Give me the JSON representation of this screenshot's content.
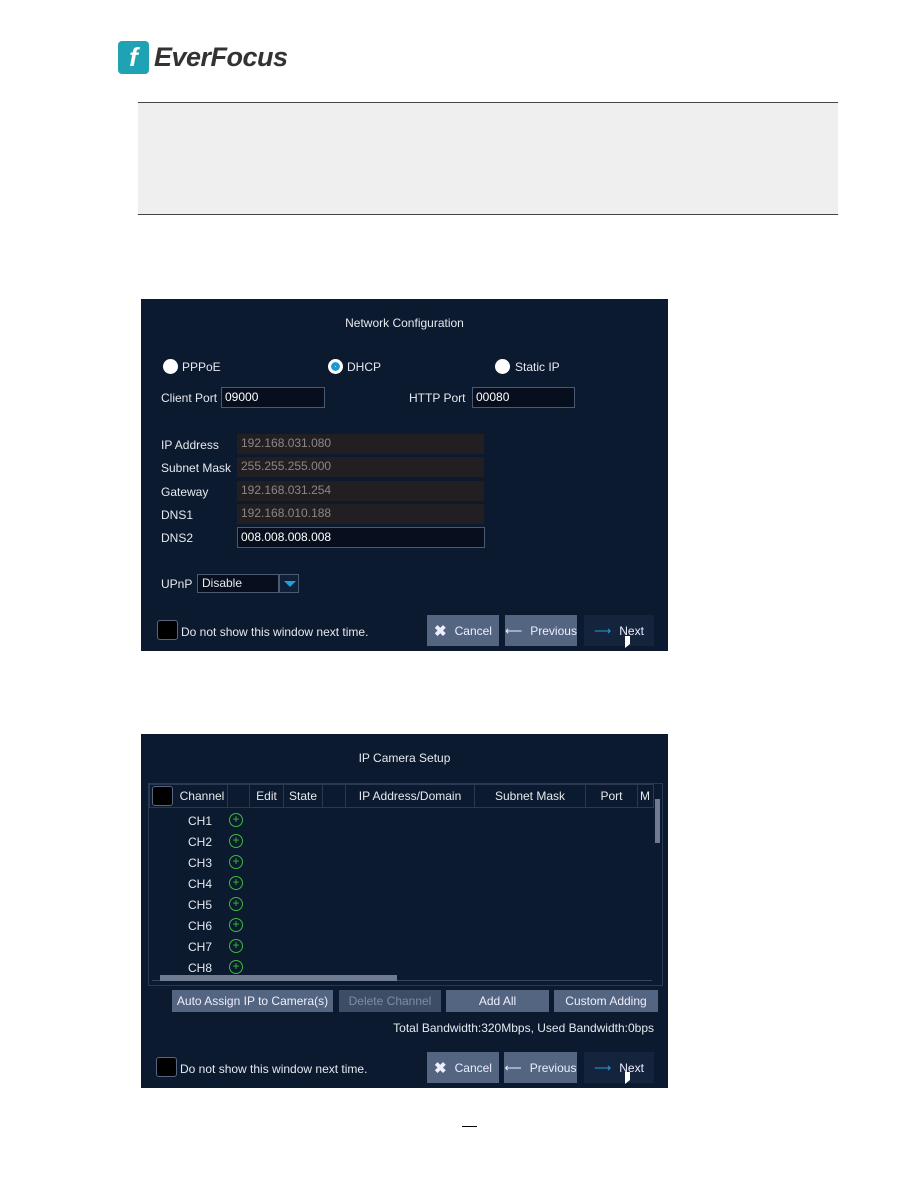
{
  "header": {
    "logo_text": "EverFocus"
  },
  "network_dialog": {
    "title": "Network Configuration",
    "modes": [
      {
        "label": "PPPoE",
        "selected": false
      },
      {
        "label": "DHCP",
        "selected": true
      },
      {
        "label": "Static IP",
        "selected": false
      }
    ],
    "client_port_label": "Client Port",
    "client_port_value": "09000",
    "http_port_label": "HTTP Port",
    "http_port_value": "00080",
    "fields": [
      {
        "label": "IP Address",
        "value": "192.168.031.080",
        "editable": false
      },
      {
        "label": "Subnet Mask",
        "value": "255.255.255.000",
        "editable": false
      },
      {
        "label": "Gateway",
        "value": "192.168.031.254",
        "editable": false
      },
      {
        "label": "DNS1",
        "value": "192.168.010.188",
        "editable": false
      },
      {
        "label": "DNS2",
        "value": "008.008.008.008",
        "editable": true
      }
    ],
    "upnp_label": "UPnP",
    "upnp_value": "Disable",
    "dont_show_label": "Do not show this window next time.",
    "cancel_label": "Cancel",
    "previous_label": "Previous",
    "next_label": "Next"
  },
  "ipcam_dialog": {
    "title": "IP Camera Setup",
    "columns": [
      "Channel",
      "",
      "Edit",
      "State",
      "",
      "IP Address/Domain",
      "Subnet Mask",
      "Port",
      "M"
    ],
    "rows": [
      "CH1",
      "CH2",
      "CH3",
      "CH4",
      "CH5",
      "CH6",
      "CH7",
      "CH8"
    ],
    "auto_assign_label": "Auto Assign IP to Camera(s)",
    "delete_label": "Delete Channel",
    "add_all_label": "Add All",
    "custom_label": "Custom Adding",
    "bandwidth": "Total Bandwidth:320Mbps, Used Bandwidth:0bps",
    "dont_show_label": "Do not show this window next time.",
    "cancel_label": "Cancel",
    "previous_label": "Previous",
    "next_label": "Next"
  },
  "colors": {
    "dialog_bg": "#0c1a2f",
    "accent": "#1a9ad0",
    "add_icon": "#3cb93c",
    "brand": "#1fa3b4"
  }
}
